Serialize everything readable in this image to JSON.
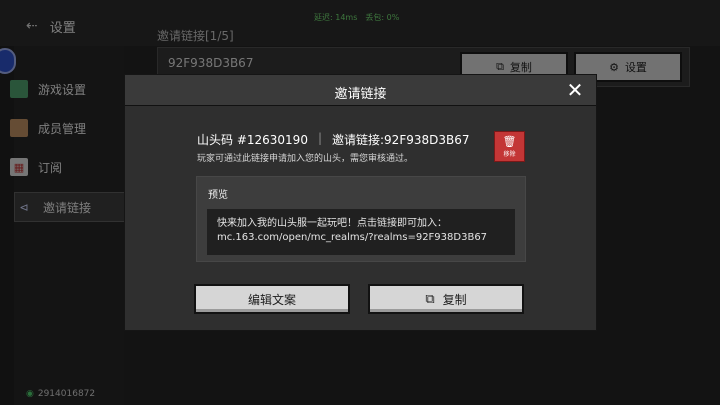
{
  "topbar": {
    "back_label": "设置",
    "latency": "延迟: 14ms",
    "packet_loss": "丢包: 0%"
  },
  "sidebar": {
    "items": [
      {
        "label": "游戏设置",
        "icon": "cube-icon"
      },
      {
        "label": "成员管理",
        "icon": "player-face-icon"
      },
      {
        "label": "订阅",
        "icon": "calendar-icon"
      },
      {
        "label": "邀请链接",
        "icon": "share-icon"
      }
    ]
  },
  "background": {
    "section_label": "邀请链接[1/5]",
    "link_code": "92F938D3B67",
    "copy_label": "复制",
    "settings_label": "设置"
  },
  "footer": {
    "id_text": "2914016872"
  },
  "modal": {
    "title": "邀请链接",
    "realm_code": "山头码 #12630190",
    "invite_link": "邀请链接:92F938D3B67",
    "description": "玩家可通过此链接申请加入您的山头，需您审核通过。",
    "remove_label": "移除",
    "preview_label": "预览",
    "preview_text": "快来加入我的山头服一起玩吧！点击链接即可加入： mc.163.com/open/mc_realms/?realms=92F938D3B67",
    "edit_label": "编辑文案",
    "copy_label": "复制"
  }
}
